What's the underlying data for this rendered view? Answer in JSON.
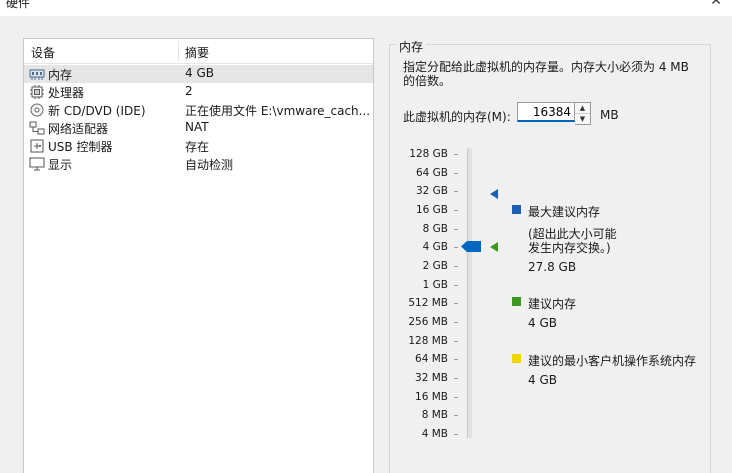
{
  "window": {
    "title": "硬件",
    "close_glyph": "✕"
  },
  "devices": {
    "columns": {
      "device": "设备",
      "summary": "摘要"
    },
    "rows": [
      {
        "name": "内存",
        "summary": "4 GB",
        "icon": "memory-icon",
        "selected": true
      },
      {
        "name": "处理器",
        "summary": "2",
        "icon": "processor-icon",
        "selected": false
      },
      {
        "name": "新 CD/DVD (IDE)",
        "summary": "正在使用文件 E:\\vmware_cach...",
        "icon": "cd-dvd-icon",
        "selected": false
      },
      {
        "name": "网络适配器",
        "summary": "NAT",
        "icon": "network-adapter-icon",
        "selected": false
      },
      {
        "name": "USB 控制器",
        "summary": "存在",
        "icon": "usb-controller-icon",
        "selected": false
      },
      {
        "name": "显示",
        "summary": "自动检测",
        "icon": "display-icon",
        "selected": false
      }
    ]
  },
  "memory": {
    "group_title": "内存",
    "description_line1": "指定分配给此虚拟机的内存量。内存大小必须为 4 MB",
    "description_line2": "的倍数。",
    "input_label": "此虚拟机的内存(M):",
    "input_value": "16384",
    "unit": "MB",
    "scale_ticks": [
      "128 GB",
      "64 GB",
      "32 GB",
      "16 GB",
      "8 GB",
      "4 GB",
      "2 GB",
      "1 GB",
      "512 MB",
      "256 MB",
      "128 MB",
      "64 MB",
      "32 MB",
      "16 MB",
      "8 MB",
      "4 MB"
    ],
    "legend": {
      "max_recommended": {
        "title": "最大建议内存",
        "note_line1": "(超出此大小可能",
        "note_line2": "发生内存交换。)",
        "value": "27.8 GB",
        "color": "#1a5fb4"
      },
      "recommended": {
        "title": "建议内存",
        "value": "4 GB",
        "color": "#3a9a1e"
      },
      "guest_min": {
        "title": "建议的最小客户机操作系统内存",
        "value": "4 GB",
        "color": "#f2d600"
      }
    },
    "colors": {
      "accent": "#0067c0"
    }
  }
}
